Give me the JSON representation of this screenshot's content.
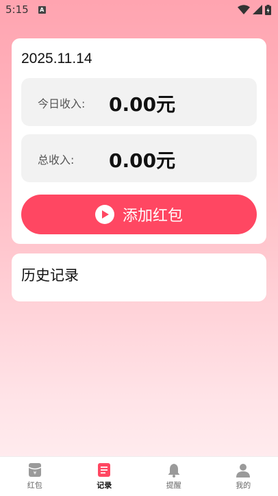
{
  "status_bar": {
    "time": "5:15",
    "notification_badge": "A"
  },
  "main": {
    "date": "2025.11.14",
    "today_income": {
      "label": "今日收入:",
      "value": "0.00元"
    },
    "total_income": {
      "label": "总收入:",
      "value": "0.00元"
    },
    "add_button_label": "添加红包"
  },
  "history": {
    "title": "历史记录"
  },
  "nav": {
    "items": [
      {
        "label": "红包",
        "icon": "wallet-icon"
      },
      {
        "label": "记录",
        "icon": "notebook-icon"
      },
      {
        "label": "提醒",
        "icon": "bell-icon"
      },
      {
        "label": "我的",
        "icon": "user-icon"
      }
    ],
    "active_index": 1
  },
  "colors": {
    "accent": "#ff4762",
    "active_nav": "#ff4762",
    "inactive_nav": "#9a9a9a"
  }
}
